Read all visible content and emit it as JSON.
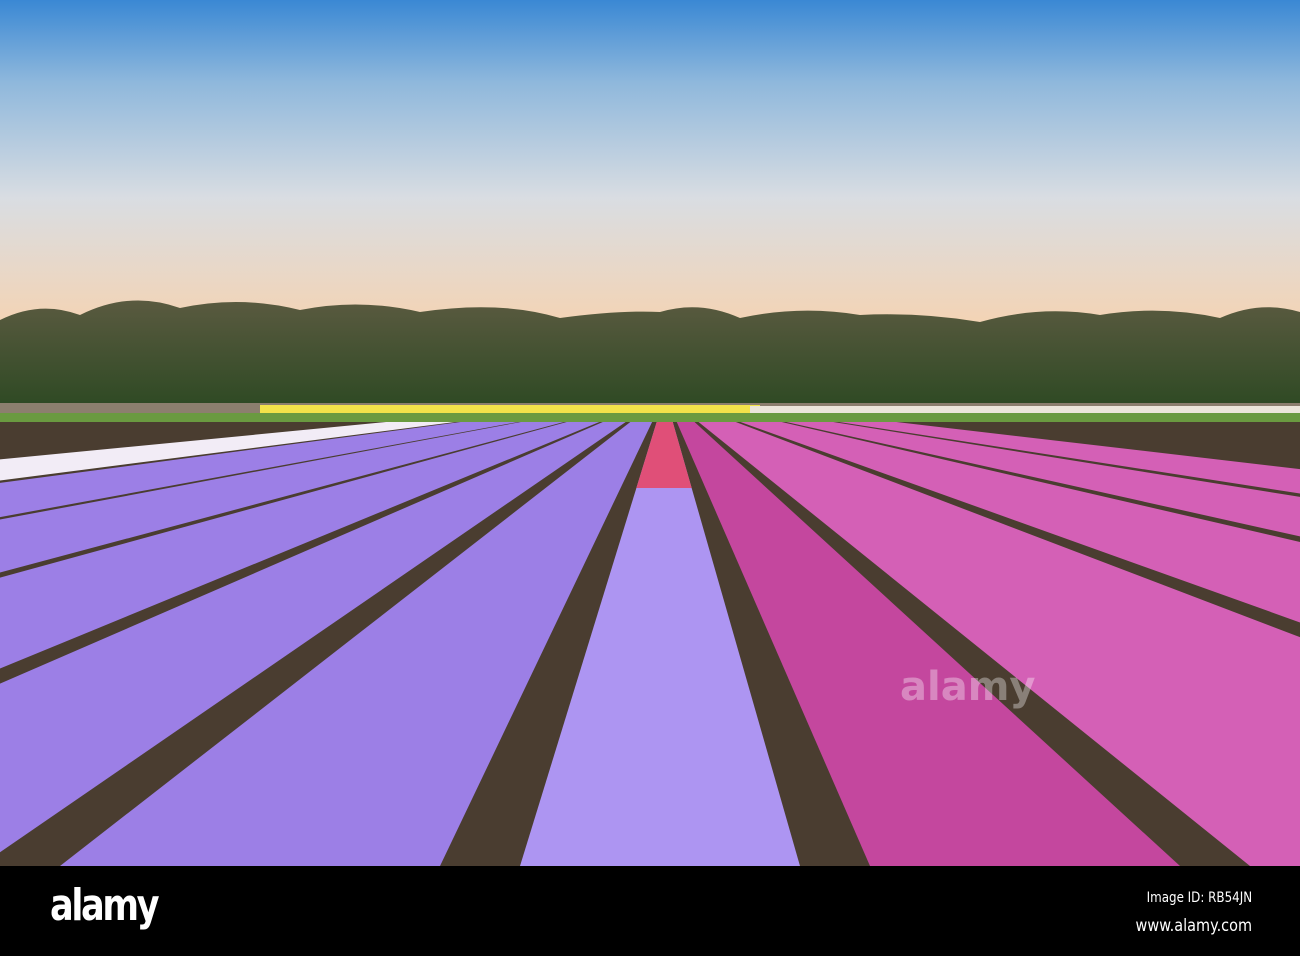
{
  "footer": {
    "logo_text": "alamy",
    "image_id": "Image ID: RB54JN",
    "website": "www.alamy.com"
  },
  "watermark": "alamy",
  "colors": {
    "sky_top": "#3f8fd8",
    "sky_mid": "#bcd2e4",
    "sky_horizon": "#f3d2b4",
    "trees": "#3c4a2c",
    "soil": "#4a3d30",
    "lavender": "#9c7fe6",
    "pale_lavender": "#ad95f2",
    "pink": "#c4479e",
    "magenta": "#d460b6",
    "red_pink": "#e04f78",
    "yellow": "#f2e24a",
    "white_row": "#f2ecf6"
  }
}
